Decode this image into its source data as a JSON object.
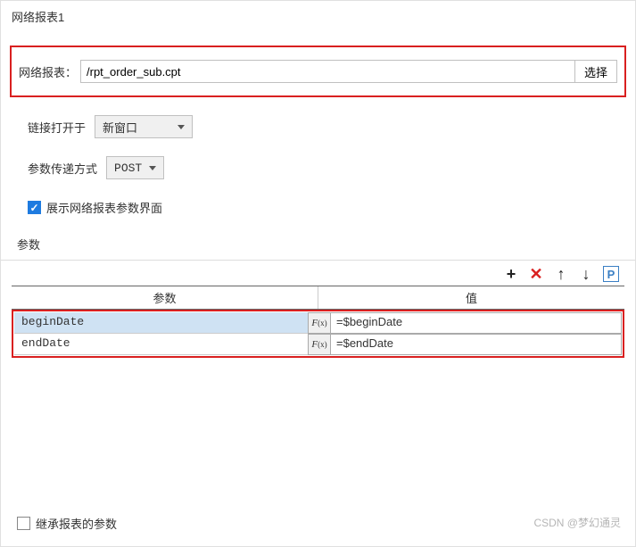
{
  "panel": {
    "title": "网络报表1"
  },
  "report": {
    "label": "网络报表：",
    "value": "/rpt_order_sub.cpt",
    "selectBtn": "选择"
  },
  "openIn": {
    "label": "链接打开于",
    "value": "新窗口"
  },
  "paramMethod": {
    "label": "参数传递方式",
    "value": "POST"
  },
  "showParamUI": {
    "label": "展示网络报表参数界面",
    "checked": true
  },
  "params": {
    "sectionLabel": "参数",
    "header": {
      "name": "参数",
      "value": "值"
    },
    "rows": [
      {
        "name": "beginDate",
        "value": "=$beginDate",
        "selected": true
      },
      {
        "name": "endDate",
        "value": "=$endDate",
        "selected": false
      }
    ],
    "toolbar": {
      "pLabel": "P"
    }
  },
  "inheritParams": {
    "label": "继承报表的参数",
    "checked": false
  },
  "watermark": "CSDN @梦幻通灵",
  "fx": {
    "f": "F",
    "x": "(x)"
  }
}
